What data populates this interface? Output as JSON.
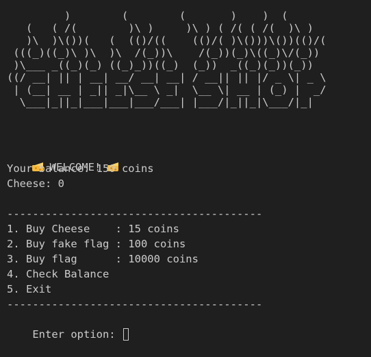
{
  "banner_art": "         )        (        (       )    )  (\n   (   ( /(        )\\ )     )\\ ) ( /( ( /(  )\\ )\n   )\\  )\\())(   (  (()/((    (()/( )\\()))\\())(()/(\n (((_)((_)\\ )\\  )\\  /(_))\\    /(_))(_)\\((_)\\/(_))\n )\\___ _((_)(_) ((_)_))((_)  (_))  _((_)(_))(_))\n((/ __| || | __| __/ __| __| / __|| || |/ _ \\| _ \\\n | (__| __ | _|| _|\\__ \\ _|  \\__ \\| __ | (_) |  _/\n  \\___|_||_|___|___|___/___| |___/|_||_|\\___/|_|",
  "welcome_text": "WELCOME!",
  "balance_line": "Your balance: 150 coins",
  "cheese_line": "Cheese: 0",
  "separator": "----------------------------------------",
  "menu": [
    "1. Buy Cheese    : 15 coins",
    "2. Buy fake flag : 100 coins",
    "3. Buy flag      : 10000 coins",
    "4. Check Balance",
    "5. Exit"
  ],
  "prompt": "Enter option: ",
  "input_value": "",
  "colors": {
    "background": "#1f1f1f",
    "text": "#cccccc",
    "cheese": "#f6b93b"
  }
}
